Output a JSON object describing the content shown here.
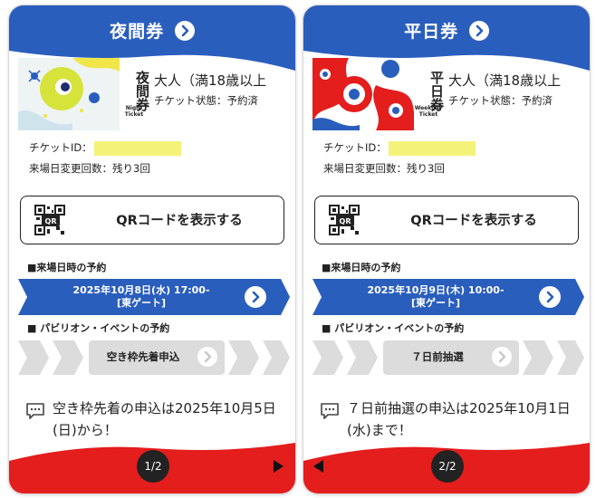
{
  "colors": {
    "brand_blue": "#2a5ebd",
    "brand_red": "#e41d1d",
    "id_mask": "#f5f27a",
    "pill_gray": "#dcdcdc"
  },
  "cards": [
    {
      "title": "夜間券",
      "thumb_name": "夜間券",
      "thumb_sub_1": "Night",
      "thumb_sub_2": "Ticket",
      "person": "大人（満18歳以上",
      "status": "チケット状態：予約済",
      "ticket_id_label": "チケットID：",
      "changes": "来場日変更回数：残り3回",
      "qr_label": "QRコードを表示する",
      "qr_icon_text": "QR",
      "visit_section": "■来場日時の予約",
      "visit_line1": "2025年10月8日(水) 17:00-",
      "visit_line2": "[東ゲート]",
      "pavilion_section": "■ パビリオン・イベントの予約",
      "pavilion_button": "空き枠先着申込",
      "note": "空き枠先着の申込は2025年10月5日(日)から！",
      "pager": "1/2"
    },
    {
      "title": "平日券",
      "thumb_name": "平日券",
      "thumb_sub_1": "Weekday",
      "thumb_sub_2": "Ticket",
      "person": "大人（満18歳以上",
      "status": "チケット状態：予約済",
      "ticket_id_label": "チケットID：",
      "changes": "来場日変更回数：残り3回",
      "qr_label": "QRコードを表示する",
      "qr_icon_text": "QR",
      "visit_section": "■来場日時の予約",
      "visit_line1": "2025年10月9日(木) 10:00-",
      "visit_line2": "[東ゲート]",
      "pavilion_section": "■ パビリオン・イベントの予約",
      "pavilion_button": "７日前抽選",
      "note": "７日前抽選の申込は2025年10月1日(水)まで！",
      "pager": "2/2"
    }
  ]
}
